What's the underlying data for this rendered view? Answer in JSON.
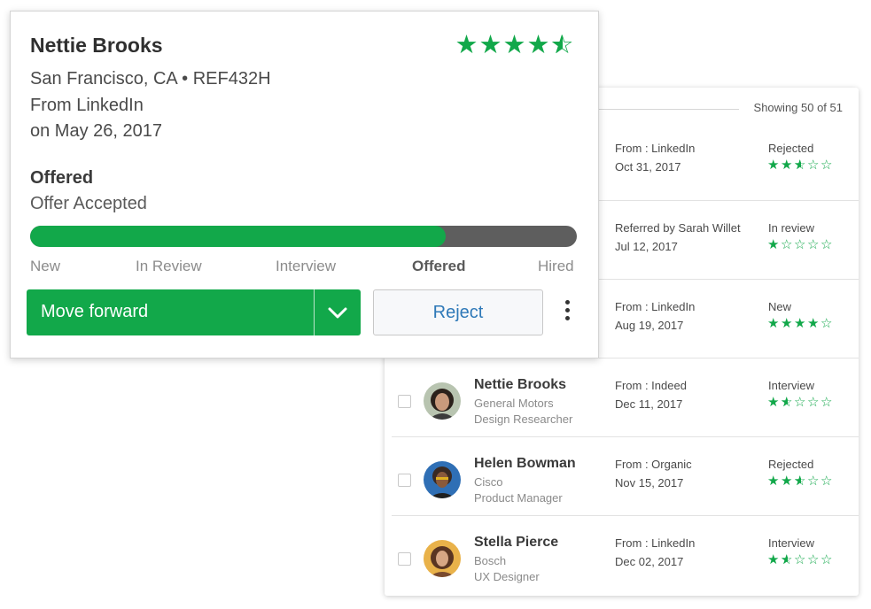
{
  "colors": {
    "accent": "#12a84a",
    "track": "#5e5e5e",
    "link": "#2f79b8"
  },
  "card": {
    "name": "Nettie Brooks",
    "rating": 4.5,
    "location": "San Francisco, CA • REF432H",
    "source": "From LinkedIn",
    "date": "on May 26, 2017",
    "stage": "Offered",
    "substatus": "Offer Accepted",
    "progress": 0.76,
    "stages": [
      "New",
      "In Review",
      "Interview",
      "Offered",
      "Hired"
    ],
    "current_stage_index": 3,
    "move_label": "Move forward",
    "reject_label": "Reject"
  },
  "list": {
    "showing": "Showing 50 of 51",
    "rows": [
      {
        "name": "",
        "company": "",
        "role": "",
        "source": "From : LinkedIn",
        "date": "Oct 31, 2017",
        "status": "Rejected",
        "rating": 2.5,
        "avatar": ""
      },
      {
        "name": "",
        "company": "",
        "role": "",
        "source": "Referred by Sarah Willet",
        "date": "Jul 12, 2017",
        "status": "In review",
        "rating": 1,
        "avatar": ""
      },
      {
        "name": "",
        "company": "",
        "role": "",
        "source": "From : LinkedIn",
        "date": "Aug 19, 2017",
        "status": "New",
        "rating": 4,
        "avatar": ""
      },
      {
        "name": "Nettie Brooks",
        "company": "General Motors",
        "role": "Design Researcher",
        "source": "From : Indeed",
        "date": "Dec 11, 2017",
        "status": "Interview",
        "rating": 1.5,
        "avatar": "woman-curly-hair"
      },
      {
        "name": "Helen Bowman",
        "company": "Cisco",
        "role": "Product Manager",
        "source": "From : Organic",
        "date": "Nov 15, 2017",
        "status": "Rejected",
        "rating": 2.5,
        "avatar": "woman-glasses"
      },
      {
        "name": "Stella Pierce",
        "company": "Bosch",
        "role": "UX Designer",
        "source": "From : LinkedIn",
        "date": "Dec 02, 2017",
        "status": "Interview",
        "rating": 1.5,
        "avatar": "woman-long-hair"
      }
    ]
  },
  "icons": {
    "caret": "chevron-down-icon",
    "more": "more-vertical-icon",
    "star": "star-icon"
  }
}
